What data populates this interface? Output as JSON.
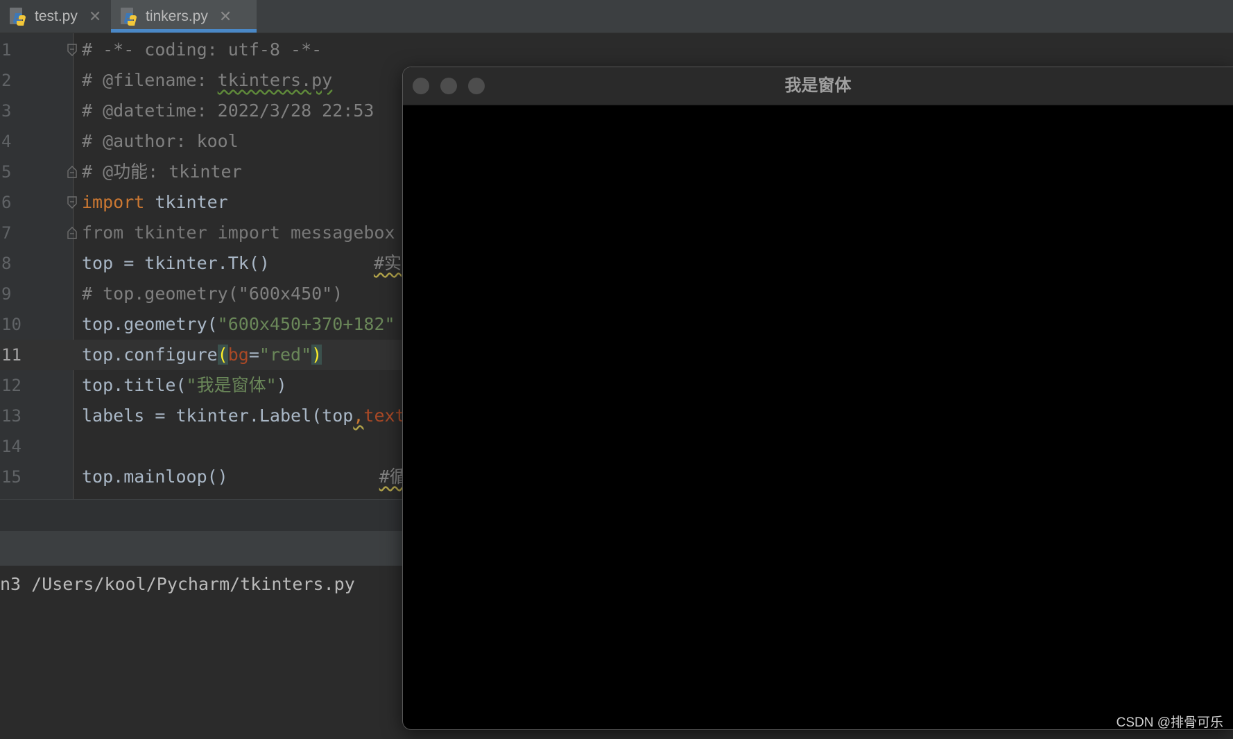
{
  "tabs": [
    {
      "label": "test.py",
      "active": false,
      "icon": "python-file-icon"
    },
    {
      "label": "tinkers.py",
      "active": true,
      "icon": "python-file-icon"
    }
  ],
  "editor": {
    "line_numbers": [
      "1",
      "2",
      "3",
      "4",
      "5",
      "6",
      "7",
      "8",
      "9",
      "10",
      "11",
      "12",
      "13",
      "14",
      "15"
    ],
    "current_line": 11,
    "lines": {
      "l1": "# -*- coding: utf-8 -*-",
      "l2_prefix": "# @filename: ",
      "l2_file": "tkinters.py",
      "l3": "# @datetime: 2022/3/28 22:53",
      "l4": "# @author: kool",
      "l5": "# @功能: tkinter",
      "l6_kw": "import",
      "l6_rest": " tkinter",
      "l7": "from tkinter import messagebox",
      "l8_code": "top = tkinter.Tk()",
      "l8_comment": "#实",
      "l9": "# top.geometry(\"600x450\")",
      "l10_code": "top.geometry(",
      "l10_str": "\"600x450+370+182\"",
      "l11_a": "top.configure",
      "l11_open": "(",
      "l11_param": "bg",
      "l11_eq": "=",
      "l11_str": "\"red\"",
      "l11_close": ")",
      "l12_a": "top.title(",
      "l12_str": "\"我是窗体\"",
      "l12_b": ")",
      "l13_a": "labels = tkinter.Label(top",
      "l13_comma": ",",
      "l13_param": "text",
      "l15_code": "top.mainloop()",
      "l15_comment": "#循"
    }
  },
  "console": {
    "run_command": "n3 /Users/kool/Pycharm/tkinters.py"
  },
  "tk_window": {
    "title": "我是窗体",
    "background": "#000000"
  },
  "watermark": "CSDN @排骨可乐",
  "colors": {
    "keyword": "#cc7832",
    "string": "#6a8759",
    "comment": "#808080",
    "param": "#aa4926",
    "text": "#a9b7c6"
  }
}
